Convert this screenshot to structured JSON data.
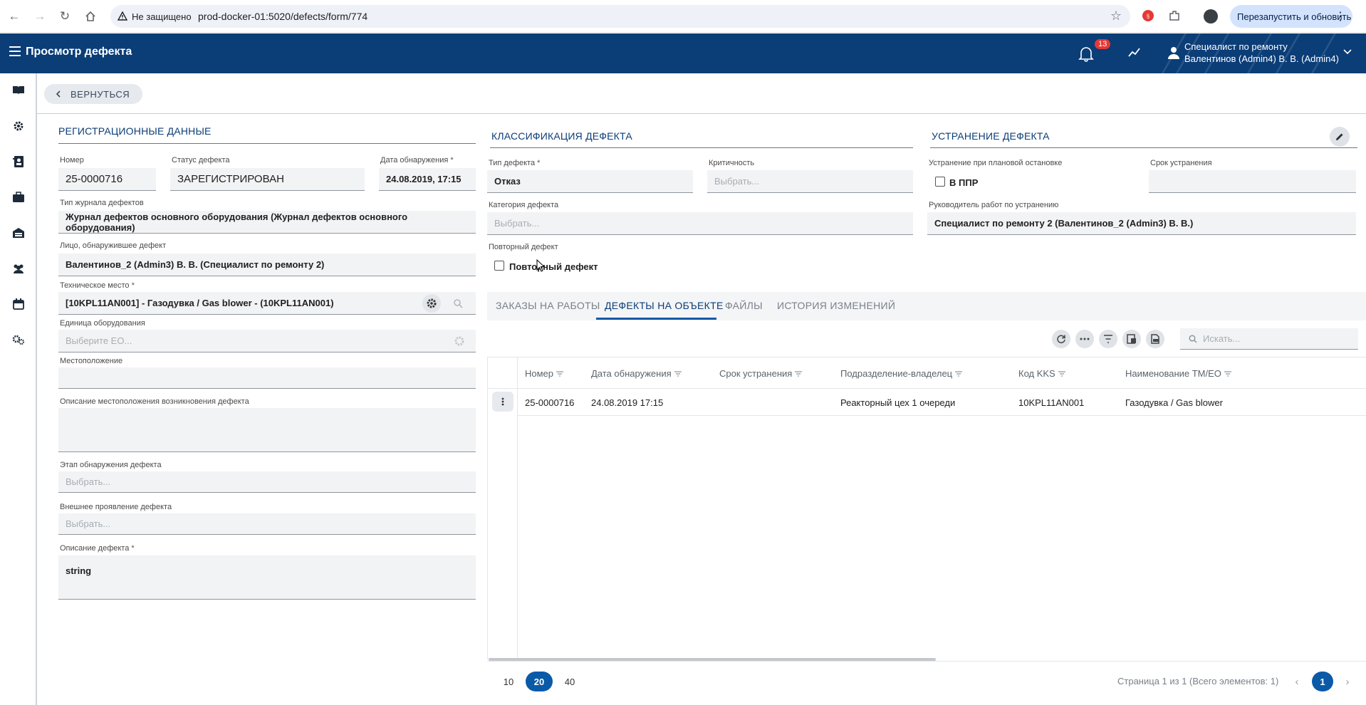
{
  "browser": {
    "security_label": "Не защищено",
    "url": "prod-docker-01:5020/defects/form/774",
    "relaunch_label": "Перезапустить и обновить"
  },
  "header": {
    "title": "Просмотр дефекта",
    "notifications_count": "13",
    "user_role": "Специалист по ремонту",
    "user_name": "Валентинов (Admin4) В. В. (Admin4)"
  },
  "toolbar": {
    "back_label": "ВЕРНУТЬСЯ"
  },
  "registration": {
    "title": "РЕГИСТРАЦИОННЫЕ ДАННЫЕ",
    "number_label": "Номер",
    "number": "25-0000716",
    "status_label": "Статус дефекта",
    "status": "ЗАРЕГИСТРИРОВАН",
    "date_label": "Дата обнаружения",
    "date": "24.08.2019, 17:15",
    "journal_label": "Тип журнала дефектов",
    "journal": "Журнал дефектов основного оборудования (Журнал дефектов основного оборудования)",
    "person_label": "Лицо, обнаружившее дефект",
    "person": "Валентинов_2 (Admin3) В. В. (Специалист по ремонту 2)",
    "tech_place_label": "Техническое место",
    "tech_place": "[10KPL11AN001] - Газодувка / Gas blower - (10KPL11AN001)",
    "equipment_label": "Единица оборудования",
    "equipment_placeholder": "Выберите ЕО...",
    "location_label": "Местоположение",
    "location": "",
    "location_desc_label": "Описание местоположения возникновения дефекта",
    "location_desc": "",
    "stage_label": "Этап обнаружения дефекта",
    "stage_placeholder": "Выбрать...",
    "manifest_label": "Внешнее проявление дефекта",
    "manifest_placeholder": "Выбрать...",
    "description_label": "Описание дефекта",
    "description": "string",
    "required_mark": "*"
  },
  "classification": {
    "title": "КЛАССИФИКАЦИЯ ДЕФЕКТА",
    "type_label": "Тип дефекта",
    "type": "Отказ",
    "criticality_label": "Критичность",
    "criticality_placeholder": "Выбрать...",
    "category_label": "Категория дефекта",
    "category_placeholder": "Выбрать...",
    "repeat_label": "Повторный дефект",
    "repeat_checkbox_label": "Повторный дефект",
    "repeat_checked": false
  },
  "elimination": {
    "title": "УСТРАНЕНИЕ ДЕФЕКТА",
    "planned_label": "Устранение при плановой остановке",
    "ppr_checkbox_label": "В ППР",
    "ppr_checked": false,
    "deadline_label": "Срок устранения",
    "deadline": "",
    "manager_label": "Руководитель работ по устранению",
    "manager": "Специалист по ремонту 2 (Валентинов_2 (Admin3) В. В.)"
  },
  "tabs": [
    {
      "label": "ЗАКАЗЫ НА РАБОТЫ",
      "active": false
    },
    {
      "label": "ДЕФЕКТЫ НА ОБЪЕКТЕ",
      "active": true
    },
    {
      "label": "ФАЙЛЫ",
      "active": false
    },
    {
      "label": "ИСТОРИЯ ИЗМЕНЕНИЙ",
      "active": false
    }
  ],
  "grid": {
    "search_placeholder": "Искать...",
    "columns": [
      "Номер",
      "Дата обнаружения",
      "Срок устранения",
      "Подразделение-владелец",
      "Код KKS",
      "Наименование ТМ/ЕО"
    ],
    "rows": [
      [
        "25-0000716",
        "24.08.2019 17:15",
        "",
        "Реакторный цех 1 очереди",
        "10KPL11AN001",
        "Газодувка / Gas blower"
      ]
    ]
  },
  "pagination": {
    "sizes": [
      "10",
      "20",
      "40"
    ],
    "active_size": "20",
    "info": "Страница 1 из 1 (Всего элементов: 1)",
    "current_page": "1"
  },
  "colors": {
    "primary": "#0b3d77",
    "accent": "#0b5aa8",
    "badge": "#e53935"
  }
}
